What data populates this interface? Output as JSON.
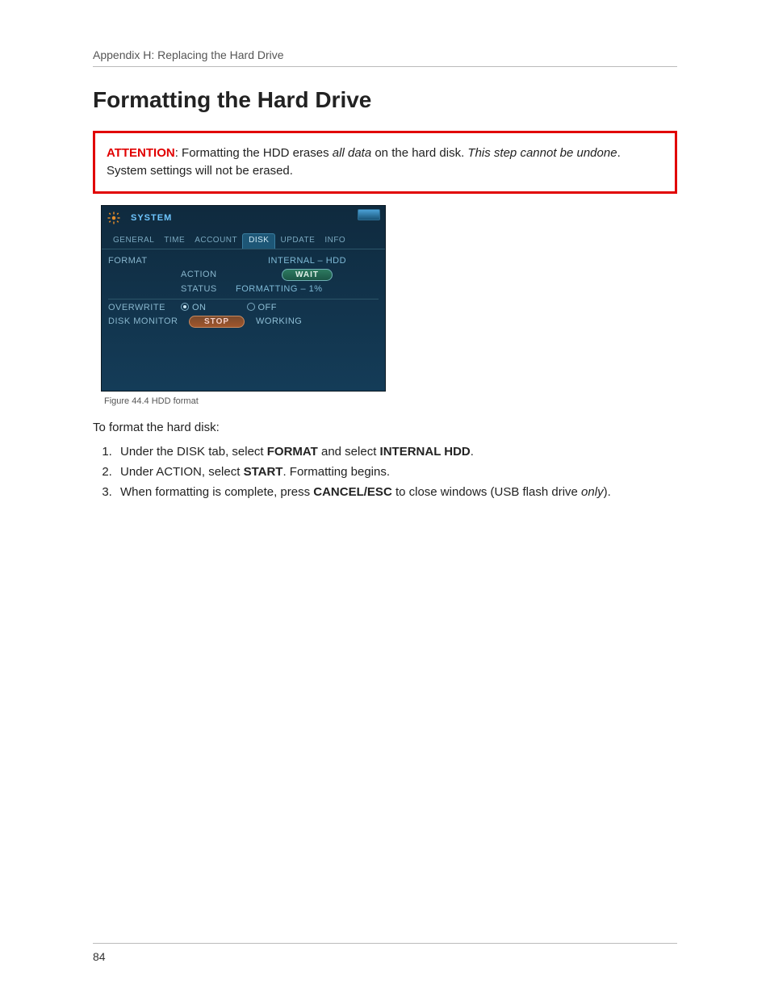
{
  "header": {
    "breadcrumb": "Appendix H: Replacing the Hard Drive"
  },
  "title": "Formatting the Hard Drive",
  "attention": {
    "label": "ATTENTION",
    "t1": ": Formatting the HDD erases ",
    "i1": "all data",
    "t2": " on the hard disk. ",
    "i2": "This step cannot be undone",
    "t3": ". System settings will not be erased."
  },
  "panel": {
    "title": "SYSTEM",
    "tabs": [
      "GENERAL",
      "TIME",
      "ACCOUNT",
      "DISK",
      "UPDATE",
      "INFO"
    ],
    "active_tab_index": 3,
    "format_label": "FORMAT",
    "internal_label": "INTERNAL – HDD",
    "action_label": "ACTION",
    "action_value": "WAIT",
    "status_label": "STATUS",
    "status_value": "FORMATTING – 1%",
    "overwrite_label": "OVERWRITE",
    "on_label": "ON",
    "off_label": "OFF",
    "diskmon_label": "DISK MONITOR",
    "stop_label": "STOP",
    "working_label": "WORKING"
  },
  "caption": "Figure 44.4 HDD format",
  "intro": "To format the hard disk:",
  "steps": {
    "s1a": "Under the DISK tab, select ",
    "s1b": "FORMAT",
    "s1c": " and select ",
    "s1d": "INTERNAL HDD",
    "s1e": ".",
    "s2a": "Under ACTION, select ",
    "s2b": "START",
    "s2c": ". Formatting begins.",
    "s3a": "When formatting is complete, press ",
    "s3b": "CANCEL/ESC",
    "s3c": " to close windows (USB flash drive ",
    "s3d": "only",
    "s3e": ")."
  },
  "page_number": "84"
}
